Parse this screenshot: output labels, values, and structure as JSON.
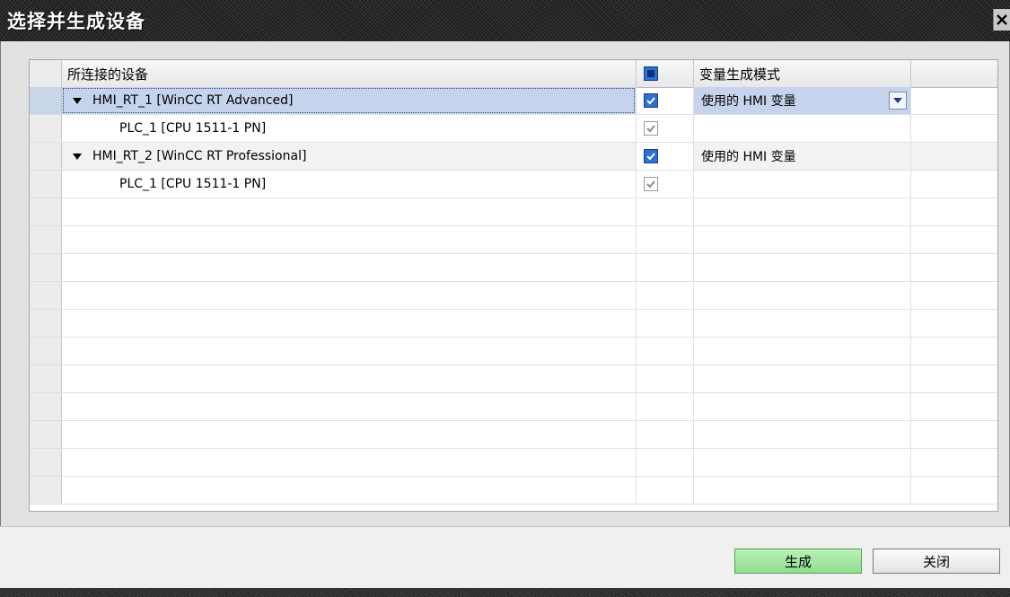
{
  "window": {
    "title": "选择并生成设备",
    "close_icon": "close-icon"
  },
  "grid": {
    "columns": {
      "device": "所连接的设备",
      "mode": "变量生成模式"
    },
    "rows": [
      {
        "device": "HMI_RT_1 [WinCC RT Advanced]",
        "checked": true,
        "mode": "使用的 HMI 变量",
        "expanded": true,
        "level": 0
      },
      {
        "device": "PLC_1 [CPU 1511-1 PN]",
        "checked": true,
        "mode": "",
        "level": 1
      },
      {
        "device": "HMI_RT_2 [WinCC RT Professional]",
        "checked": true,
        "mode": "使用的 HMI 变量",
        "expanded": true,
        "level": 0
      },
      {
        "device": "PLC_1 [CPU 1511-1 PN]",
        "checked": true,
        "mode": "",
        "level": 1
      }
    ]
  },
  "buttons": {
    "generate": "生成",
    "close": "关闭"
  },
  "colors": {
    "accent_blue": "#2d6fd3",
    "generate_green": "#8fde8f",
    "selection": "#c5d3ec"
  }
}
